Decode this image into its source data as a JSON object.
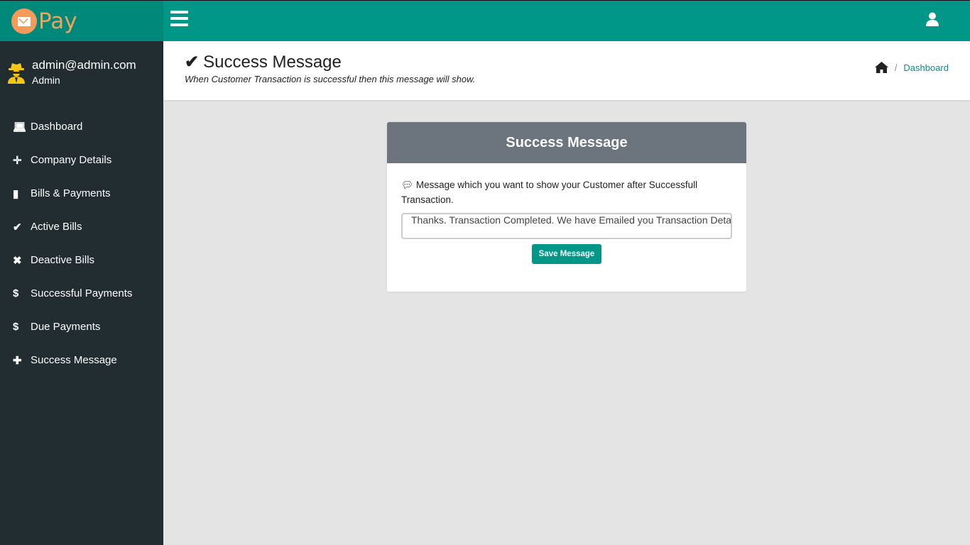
{
  "brand": {
    "name": "Pay"
  },
  "user": {
    "email": "admin@admin.com",
    "role": "Admin"
  },
  "nav": [
    {
      "label": "Dashboard",
      "icon": "laptop-icon"
    },
    {
      "label": "Company Details",
      "icon": "arrows-icon"
    },
    {
      "label": "Bills & Payments",
      "icon": "file-icon"
    },
    {
      "label": "Active Bills",
      "icon": "check-icon"
    },
    {
      "label": "Deactive Bills",
      "icon": "times-icon"
    },
    {
      "label": "Successful Payments",
      "icon": "dollar-icon"
    },
    {
      "label": "Due Payments",
      "icon": "dollar-icon"
    },
    {
      "label": "Success Message",
      "icon": "plus-icon"
    }
  ],
  "header": {
    "title": "Success Message",
    "subtitle": "When Customer Transaction is successful then this message will show.",
    "breadcrumb": "Dashboard",
    "separator": "/"
  },
  "card": {
    "title": "Success Message",
    "label": "Message which you want to show your Customer after Successfull Transaction.",
    "input_value": "Thanks. Transaction  Completed. We have Emailed you Transaction Deta",
    "button": "Save Message"
  },
  "colors": {
    "primary": "#009688",
    "sidebar": "#222d32",
    "card_header": "#6c757d",
    "logo": "#f79a58"
  }
}
